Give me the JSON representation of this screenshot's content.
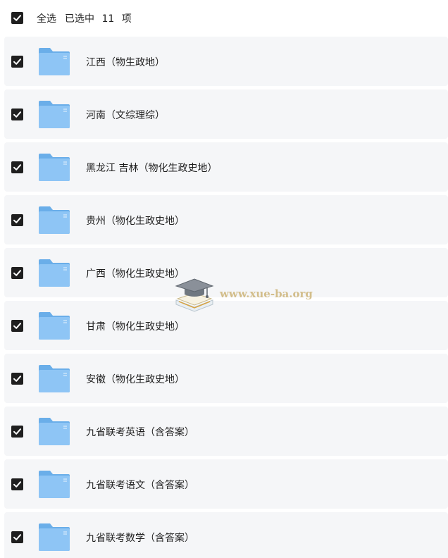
{
  "header": {
    "select_all_label": "全选",
    "selected_count_text": "已选中 11 项"
  },
  "folders": [
    {
      "name": "江西（物生政地）",
      "checked": true
    },
    {
      "name": "河南（文综理综）",
      "checked": true
    },
    {
      "name": "黑龙江 吉林（物化生政史地）",
      "checked": true
    },
    {
      "name": "贵州（物化生政史地）",
      "checked": true
    },
    {
      "name": "广西（物化生政史地）",
      "checked": true
    },
    {
      "name": "甘肃（物化生政史地）",
      "checked": true
    },
    {
      "name": "安徽（物化生政史地）",
      "checked": true
    },
    {
      "name": "九省联考英语（含答案）",
      "checked": true
    },
    {
      "name": "九省联考语文（含答案）",
      "checked": true
    },
    {
      "name": "九省联考数学（含答案）",
      "checked": true
    }
  ],
  "watermark": {
    "text": "www.xue-ba.org",
    "icon": "graduation-cap-book-icon"
  },
  "colors": {
    "checkbox": "#1f1f1f",
    "row_background": "#f5f6f8",
    "folder_light": "#8ec5f5",
    "folder_dark": "#6aaee9",
    "watermark": "#cdb478"
  }
}
